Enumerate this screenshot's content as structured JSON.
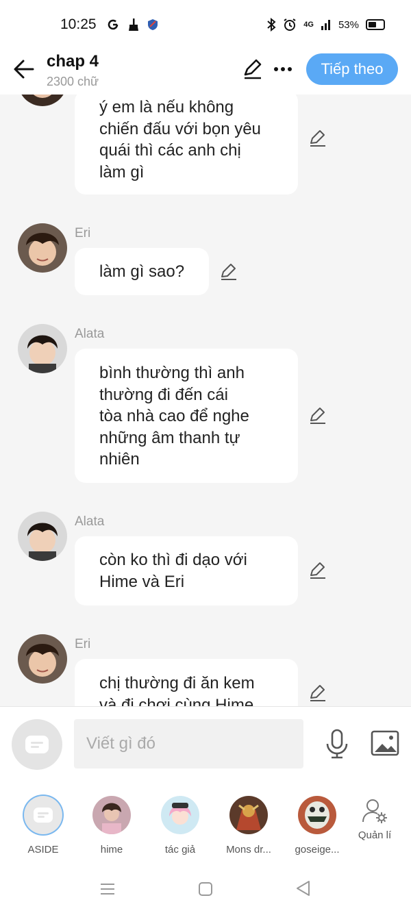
{
  "status_bar": {
    "time": "10:25",
    "battery": "53%",
    "network": "4G"
  },
  "header": {
    "title": "chap 4",
    "subtitle": "2300 chữ",
    "next_label": "Tiếp theo"
  },
  "messages": [
    {
      "sender": "",
      "text": "ý em là nếu không\nchiến đấu với bọn yêu\nquái thì các anh chị\nlàm gì"
    },
    {
      "sender": "Eri",
      "text": "làm gì sao?"
    },
    {
      "sender": "Alata",
      "text": "bình thường thì anh\nthường đi đến cái\ntòa nhà cao để nghe\nnhững âm thanh tự\nnhiên"
    },
    {
      "sender": "Alata",
      "text": "còn ko thì đi dạo với\nHime và Eri"
    },
    {
      "sender": "Eri",
      "text": "chị thường đi ăn kem\nvà đi chơi cùng Hime"
    }
  ],
  "composer": {
    "placeholder": "Viết gì đó"
  },
  "characters": [
    {
      "label": "ASIDE"
    },
    {
      "label": "hime"
    },
    {
      "label": "tác giả"
    },
    {
      "label": "Mons dr..."
    },
    {
      "label": "goseige..."
    },
    {
      "label": "Quản lí"
    }
  ],
  "colors": {
    "accent": "#5aa9f5",
    "background": "#f5f5f5",
    "bubble": "#ffffff"
  }
}
